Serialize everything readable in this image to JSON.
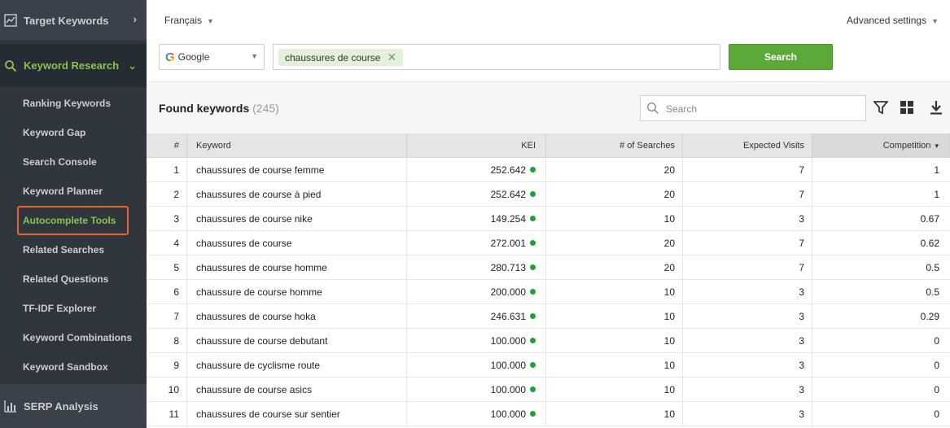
{
  "sidebar": {
    "target_keywords": "Target Keywords",
    "keyword_research": "Keyword Research",
    "items": [
      "Ranking Keywords",
      "Keyword Gap",
      "Search Console",
      "Keyword Planner",
      "Autocomplete Tools",
      "Related Searches",
      "Related Questions",
      "TF-IDF Explorer",
      "Keyword Combinations",
      "Keyword Sandbox"
    ],
    "active_item": "Autocomplete Tools",
    "serp_analysis": "SERP Analysis"
  },
  "topbar": {
    "language": "Français",
    "advanced_settings": "Advanced settings",
    "engine": "Google",
    "keyword_tag": "chaussures de course",
    "search_button": "Search"
  },
  "results": {
    "title": "Found keywords",
    "count": "(245)",
    "search_placeholder": "Search"
  },
  "table": {
    "headers": [
      "#",
      "Keyword",
      "KEI",
      "# of Searches",
      "Expected Visits",
      "Competition"
    ],
    "sort_indicator": "▾",
    "rows": [
      {
        "num": "1",
        "keyword": "chaussures de course femme",
        "kei": "252.642",
        "searches": "20",
        "visits": "7",
        "competition": "1"
      },
      {
        "num": "2",
        "keyword": "chaussures de course à pied",
        "kei": "252.642",
        "searches": "20",
        "visits": "7",
        "competition": "1"
      },
      {
        "num": "3",
        "keyword": "chaussures de course nike",
        "kei": "149.254",
        "searches": "10",
        "visits": "3",
        "competition": "0.67"
      },
      {
        "num": "4",
        "keyword": "chaussures de course",
        "kei": "272.001",
        "searches": "20",
        "visits": "7",
        "competition": "0.62"
      },
      {
        "num": "5",
        "keyword": "chaussures de course homme",
        "kei": "280.713",
        "searches": "20",
        "visits": "7",
        "competition": "0.5"
      },
      {
        "num": "6",
        "keyword": "chaussure de course homme",
        "kei": "200.000",
        "searches": "10",
        "visits": "3",
        "competition": "0.5"
      },
      {
        "num": "7",
        "keyword": "chaussures de course hoka",
        "kei": "246.631",
        "searches": "10",
        "visits": "3",
        "competition": "0.29"
      },
      {
        "num": "8",
        "keyword": "chaussure de course debutant",
        "kei": "100.000",
        "searches": "10",
        "visits": "3",
        "competition": "0"
      },
      {
        "num": "9",
        "keyword": "chaussure de cyclisme route",
        "kei": "100.000",
        "searches": "10",
        "visits": "3",
        "competition": "0"
      },
      {
        "num": "10",
        "keyword": "chaussure de course asics",
        "kei": "100.000",
        "searches": "10",
        "visits": "3",
        "competition": "0"
      },
      {
        "num": "11",
        "keyword": "chaussures de course sur sentier",
        "kei": "100.000",
        "searches": "10",
        "visits": "3",
        "competition": "0"
      }
    ]
  },
  "colors": {
    "accent_green": "#8bc34a",
    "button_green": "#5ca838",
    "kei_dot": "#1aa532",
    "highlight_border": "#e8662c"
  }
}
